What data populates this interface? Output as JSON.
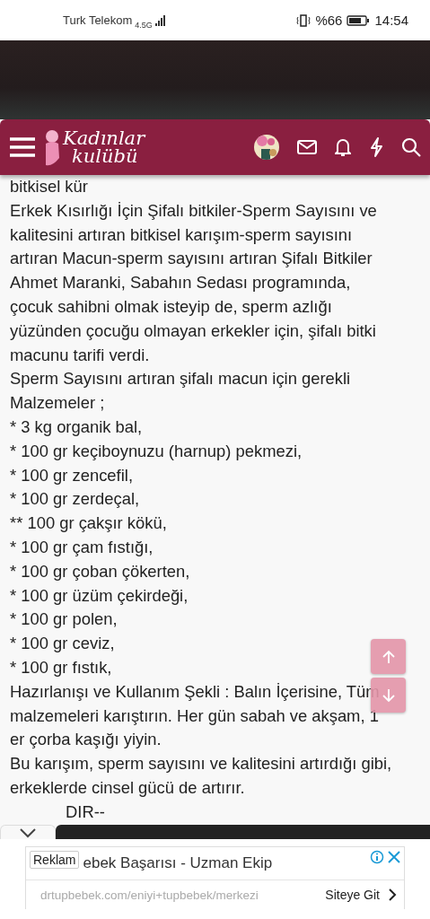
{
  "status_bar": {
    "carrier": "Turk Telekom",
    "network": "4.5G",
    "battery": "%66",
    "time": "14:54"
  },
  "header": {
    "logo_lines": [
      "Kadınlar",
      "kulübü"
    ]
  },
  "article": {
    "lines": [
      "bitkisel kür",
      "Erkek Kısırlığı İçin Şifalı bitkiler-Sperm Sayısını ve",
      "kalitesini artıran bitkisel karışım-sperm sayısını",
      "artıran Macun-sperm sayısını artıran Şifalı Bitkiler",
      "Ahmet Maranki, Sabahın Sedası programında,",
      "çocuk sahibni olmak isteyip de, sperm azlığı",
      "yüzünden çocuğu olmayan erkekler için, şifalı bitki",
      "macunu tarifi verdi.",
      "Sperm Sayısını artıran şifalı macun için gerekli",
      "Malzemeler ;",
      "* 3 kg organik bal,",
      "* 100 gr keçiboynuzu (harnup) pekmezi,",
      "* 100 gr zencefil,",
      "* 100 gr zerdeçal,",
      "** 100 gr çakşır kökü,",
      "* 100 gr çam fıstığı,",
      "* 100 gr çoban çökerten,",
      "* 100 gr üzüm çekirdeği,",
      "* 100 gr polen,",
      "* 100 gr ceviz,",
      "* 100 gr fıstık,",
      "Hazırlanışı ve Kullanım Şekli : Balın İçerisine, Tüm",
      "malzemeleri karıştırın. Her gün sabah ve akşam, 1",
      "er çorba kaşığı yiyin.",
      "Bu karışım, sperm sayısını ve kalitesini artırdığı gibi,",
      "erkeklerde cinsel gücü de artırır.",
      "DIR--"
    ]
  },
  "ad": {
    "label": "Reklam",
    "title": "ebek Başarısı - Uzman Ekip",
    "url": "drtupbebek.com/eniyi+tupbebek/merkezi",
    "cta": "Siteye Git"
  }
}
